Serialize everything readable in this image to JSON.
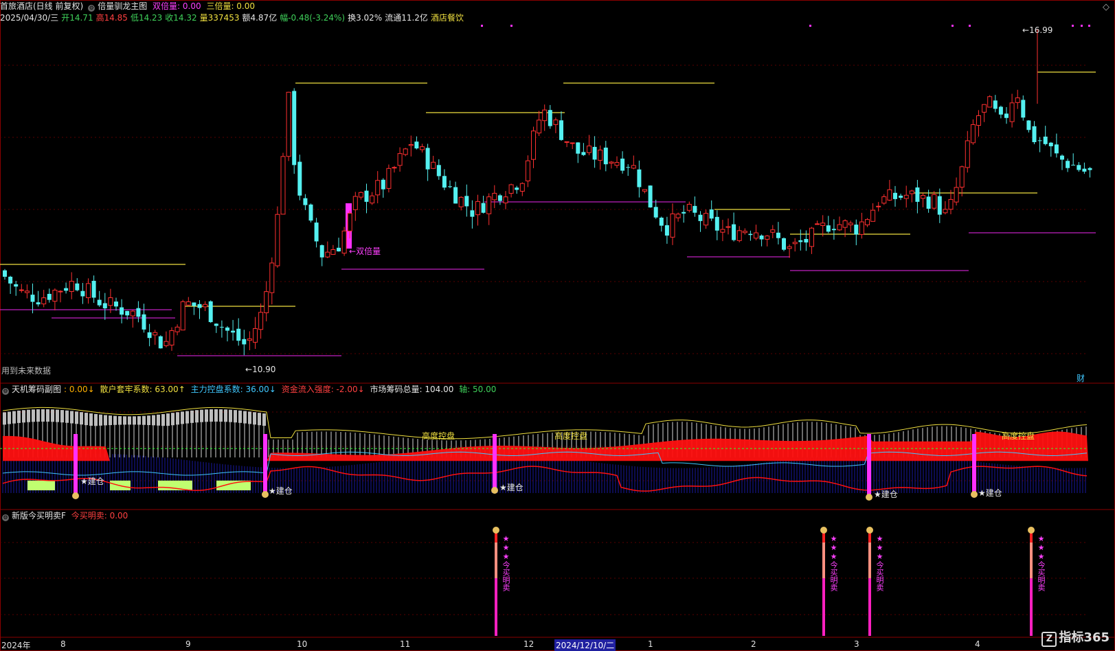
{
  "main": {
    "stock": "首旅酒店(日线 前复权)",
    "indicator": "倍量驯龙主图",
    "double_label": "双倍量: 0.00",
    "triple_label": "三倍量: 0.00",
    "date": "2025/04/30/三",
    "open_label": "开14.71",
    "high_label": "高14.85",
    "low_label": "低14.23",
    "close_label": "收14.32",
    "volume_label": "量337453",
    "amount_label": "额4.87亿",
    "change_label": "幅-0.48(-3.24%)",
    "turnover_label": "换3.02%",
    "float_label": "流通11.2亿",
    "sector_label": "酒店餐饮",
    "high_mark": "16.99",
    "low_mark": "10.90",
    "double_vol_annot": "双倍量",
    "future_data": "用到未来数据",
    "side_tag": "财"
  },
  "sub1": {
    "name": "天机筹码副图",
    "v0": ": 0.00↓",
    "retail_label": "散户套牢系数: 63.00↑",
    "main_label": "主力控盘系数: 36.00↓",
    "flow_label": "资金流入强度: -2.00↓",
    "total_label": "市场筹码总量: 104.00",
    "axis_label": "轴: 50.00",
    "high_control": "高度控盘",
    "build": "建仓"
  },
  "sub2": {
    "name": "新版今买明卖F",
    "value_label": "今买明卖: 0.00",
    "buy_text": "今买明卖"
  },
  "xaxis": {
    "labels": [
      "2024年",
      "8",
      "9",
      "10",
      "11",
      "12",
      "2024/12/10/二",
      "1",
      "2",
      "3",
      "4"
    ]
  },
  "logo": {
    "text": "指标365",
    "mark": "Z"
  }
}
